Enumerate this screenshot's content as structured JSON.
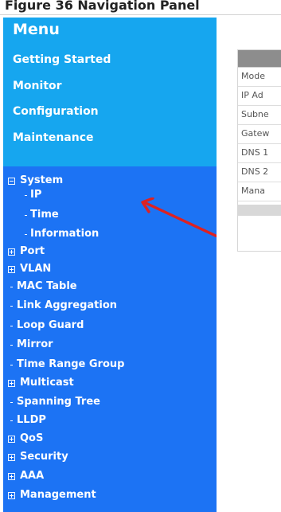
{
  "cut_header": {
    "text": "Figure 36 Navigation Panel"
  },
  "sidebar": {
    "title": "Menu",
    "top_links": [
      "Getting Started",
      "Monitor",
      "Configuration",
      "Maintenance"
    ],
    "tree": [
      {
        "label": "System",
        "kind": "expanded"
      },
      {
        "label": "IP",
        "kind": "child"
      },
      {
        "label": "Time",
        "kind": "child"
      },
      {
        "label": "Information",
        "kind": "child"
      },
      {
        "label": "Port",
        "kind": "collapsed"
      },
      {
        "label": "VLAN",
        "kind": "collapsed"
      },
      {
        "label": "MAC Table",
        "kind": "leaf"
      },
      {
        "label": "Link Aggregation",
        "kind": "leaf"
      },
      {
        "label": "Loop Guard",
        "kind": "leaf"
      },
      {
        "label": "Mirror",
        "kind": "leaf"
      },
      {
        "label": "Time Range Group",
        "kind": "leaf"
      },
      {
        "label": "Multicast",
        "kind": "collapsed"
      },
      {
        "label": "Spanning Tree",
        "kind": "leaf"
      },
      {
        "label": "LLDP",
        "kind": "leaf"
      },
      {
        "label": "QoS",
        "kind": "collapsed"
      },
      {
        "label": "Security",
        "kind": "collapsed"
      },
      {
        "label": "AAA",
        "kind": "collapsed"
      },
      {
        "label": "Management",
        "kind": "collapsed"
      }
    ]
  },
  "table": {
    "rows": [
      "Mode",
      "IP Ad",
      "Subne",
      "Gatew",
      "DNS 1",
      "DNS 2",
      "Mana"
    ]
  },
  "colors": {
    "sidebar_blue": "#1c73f4",
    "top_block_blue": "#16a6ef",
    "arrow_red": "#dd2222"
  },
  "icons": {
    "expanded": "minus-box-icon",
    "collapsed": "plus-box-icon",
    "leaf": "bullet-icon",
    "annotation": "red-arrow-icon"
  }
}
